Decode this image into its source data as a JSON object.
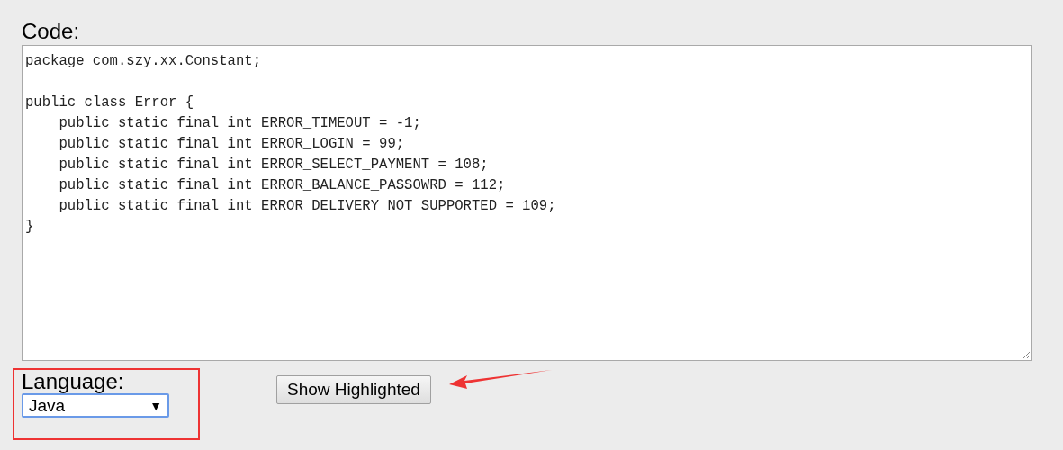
{
  "code_label": "Code:",
  "code": "package com.szy.xx.Constant;\n\npublic class Error {\n    public static final int ERROR_TIMEOUT = -1;\n    public static final int ERROR_LOGIN = 99;\n    public static final int ERROR_SELECT_PAYMENT = 108;\n    public static final int ERROR_BALANCE_PASSOWRD = 112;\n    public static final int ERROR_DELIVERY_NOT_SUPPORTED = 109;\n}",
  "language": {
    "label": "Language:",
    "value": "Java",
    "arrow": "▼"
  },
  "button": "Show Highlighted"
}
